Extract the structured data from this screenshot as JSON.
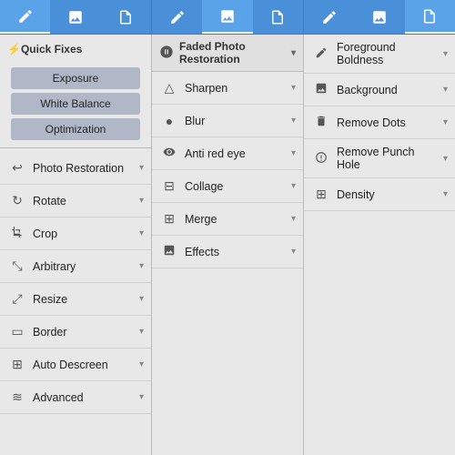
{
  "tabs": {
    "sections": [
      {
        "items": [
          {
            "icon": "✏️",
            "active": true
          },
          {
            "icon": "🖼️",
            "active": false
          },
          {
            "icon": "📄",
            "active": false
          }
        ]
      },
      {
        "items": [
          {
            "icon": "✏️",
            "active": false
          },
          {
            "icon": "🖼️",
            "active": true
          },
          {
            "icon": "📄",
            "active": false
          }
        ]
      },
      {
        "items": [
          {
            "icon": "✏️",
            "active": false
          },
          {
            "icon": "🖼️",
            "active": false
          },
          {
            "icon": "📄",
            "active": true
          }
        ]
      }
    ]
  },
  "panel1": {
    "quick_fixes_label": "Quick Fixes",
    "buttons": [
      "Exposure",
      "White Balance",
      "Optimization"
    ],
    "menu_items": [
      {
        "label": "Photo Restoration",
        "icon": "↩"
      },
      {
        "label": "Rotate",
        "icon": "↻"
      },
      {
        "label": "Crop",
        "icon": "⊡"
      },
      {
        "label": "Arbitrary",
        "icon": "⤡"
      },
      {
        "label": "Resize",
        "icon": "⤢"
      },
      {
        "label": "Border",
        "icon": "▭"
      },
      {
        "label": "Auto Descreen",
        "icon": "⊞"
      },
      {
        "label": "Advanced",
        "icon": "≋"
      }
    ]
  },
  "panel2": {
    "header_label": "Faded Photo Restoration",
    "menu_items": [
      {
        "label": "Sharpen",
        "icon": "△"
      },
      {
        "label": "Blur",
        "icon": "●"
      },
      {
        "label": "Anti red eye",
        "icon": "👁"
      },
      {
        "label": "Collage",
        "icon": "⊟"
      },
      {
        "label": "Merge",
        "icon": "⊞"
      },
      {
        "label": "Effects",
        "icon": "🖼"
      }
    ]
  },
  "panel3": {
    "menu_items": [
      {
        "label": "Foreground Boldness",
        "icon": "✏"
      },
      {
        "label": "Background",
        "icon": "🖼"
      },
      {
        "label": "Remove Dots",
        "icon": "✂"
      },
      {
        "label": "Remove Punch Hole",
        "icon": "⊙"
      },
      {
        "label": "Density",
        "icon": "⊞"
      }
    ]
  }
}
